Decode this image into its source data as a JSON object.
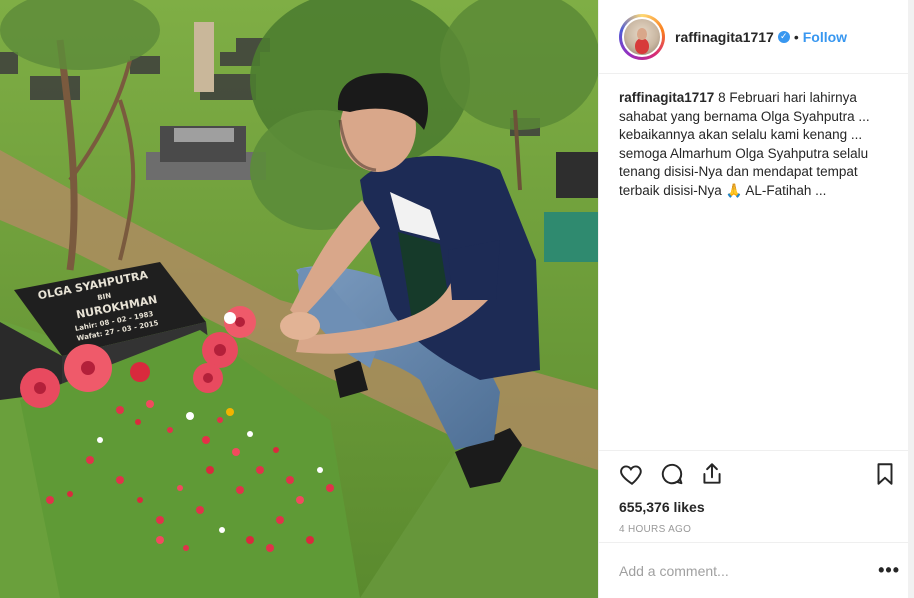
{
  "post": {
    "username": "raffinagita1717",
    "separator": "•",
    "follow_label": "Follow",
    "verified_symbol": "✓",
    "caption_user": "raffinagita1717",
    "caption_text": "8 Februari hari lahirnya sahabat yang bernama Olga Syahputra ... kebaikannya akan selalu kami kenang ... semoga Almarhum Olga Syahputra selalu tenang disisi-Nya dan mendapat tempat terbaik disisi-Nya 🙏 AL-Fatihah ...",
    "likes": "655,376 likes",
    "time": "4 HOURS AGO",
    "comment_placeholder": "Add a comment...",
    "more_label": "•••"
  },
  "photo": {
    "headstone_line1": "OLGA SYAHPUTRA",
    "headstone_line2": "BIN",
    "headstone_line3": "NUROKHMAN",
    "headstone_line4": "Lahir: 08 - 02 - 1983",
    "headstone_line5": "Wafat: 27 - 03 - 2015"
  },
  "icons": [
    "heart-icon",
    "comment-icon",
    "share-icon",
    "bookmark-icon",
    "verified-icon"
  ],
  "colors": {
    "accent": "#3897f0",
    "text": "#262626",
    "muted": "#999999",
    "border": "#efefef"
  }
}
